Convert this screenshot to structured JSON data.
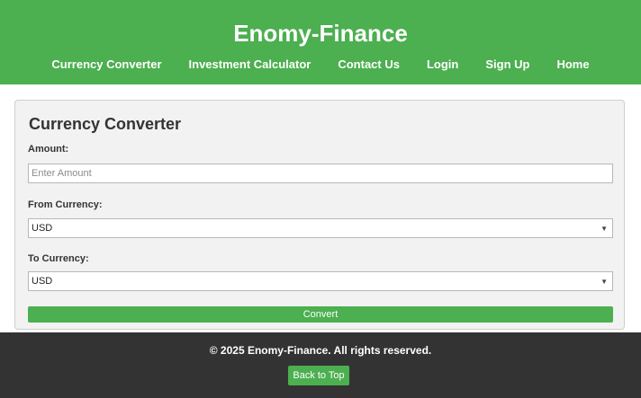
{
  "header": {
    "title": "Enomy-Finance",
    "nav": [
      {
        "label": "Currency Converter"
      },
      {
        "label": "Investment Calculator"
      },
      {
        "label": "Contact Us"
      },
      {
        "label": "Login"
      },
      {
        "label": "Sign Up"
      },
      {
        "label": "Home"
      }
    ],
    "colors": {
      "background": "#4caf50",
      "text": "#ffffff"
    }
  },
  "converter": {
    "title": "Currency Converter",
    "amount_label": "Amount:",
    "amount_placeholder": "Enter Amount",
    "amount_value": "",
    "from_label": "From Currency:",
    "from_value": "USD",
    "to_label": "To Currency:",
    "to_value": "USD",
    "convert_label": "Convert",
    "select_icon": "chevron-down-icon"
  },
  "footer": {
    "copyright": "© 2025 Enomy-Finance. All rights reserved.",
    "back_to_top_label": "Back to Top",
    "colors": {
      "background": "#333333",
      "button": "#4caf50"
    }
  }
}
